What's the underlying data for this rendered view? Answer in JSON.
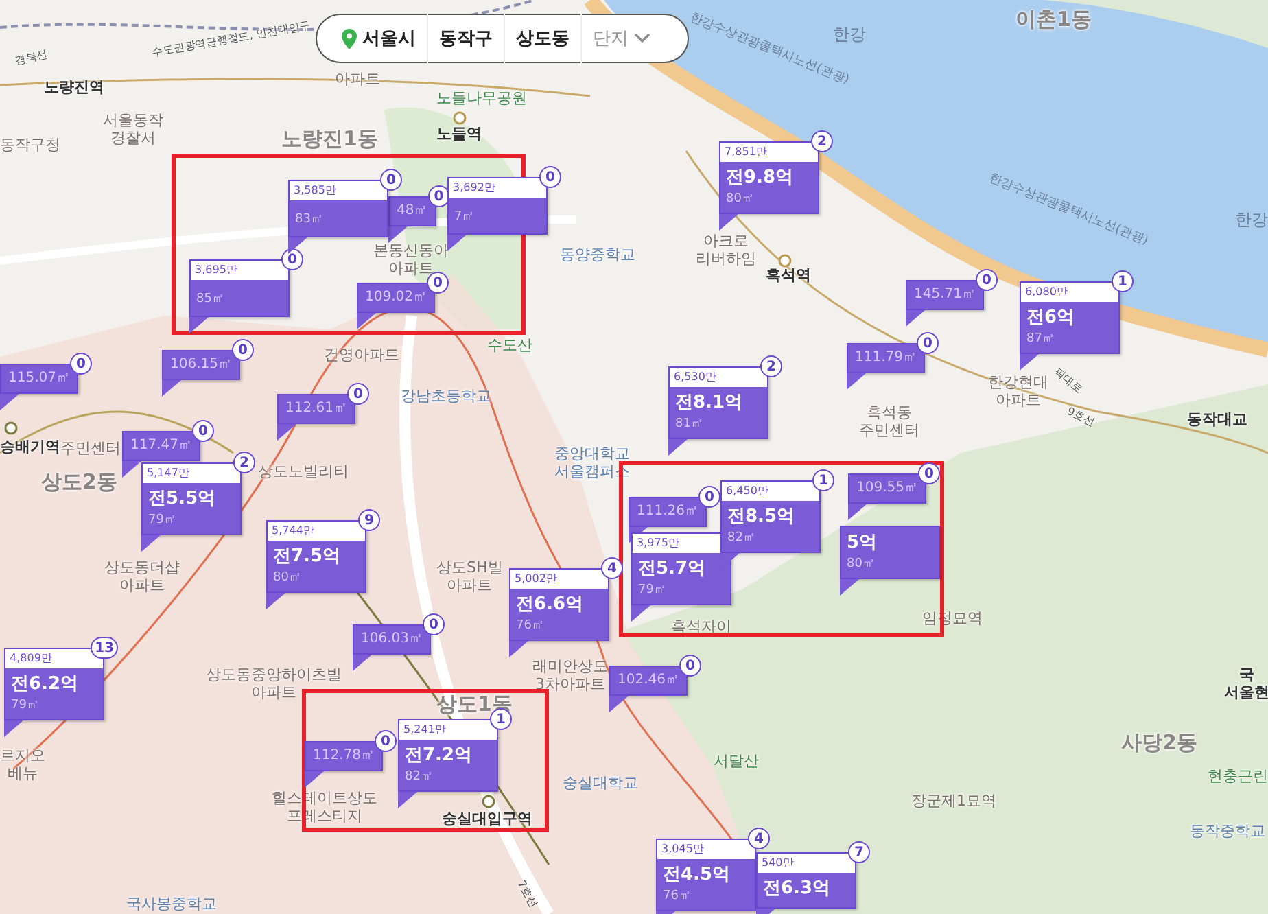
{
  "breadcrumb": {
    "items": [
      {
        "label": "서울시",
        "kind": "city"
      },
      {
        "label": "동작구",
        "kind": "region"
      },
      {
        "label": "상도동",
        "kind": "region"
      },
      {
        "label": "단지",
        "kind": "dropdown"
      }
    ]
  },
  "places": [
    {
      "text": "경북선",
      "kind": "line"
    },
    {
      "text": "수도권광역급행철도, 인천대입구",
      "kind": "line"
    },
    {
      "text": "노량진역",
      "kind": "station"
    },
    {
      "text": "서울동작\n경찰서",
      "kind": "poi"
    },
    {
      "text": "동작구청",
      "kind": "poi"
    },
    {
      "text": "아파트",
      "kind": "poi"
    },
    {
      "text": "노들나무공원",
      "kind": "park"
    },
    {
      "text": "노량진1동",
      "kind": "district"
    },
    {
      "text": "노들역",
      "kind": "station"
    },
    {
      "text": "본동신동아\n아파트",
      "kind": "poi"
    },
    {
      "text": "동양중학교",
      "kind": "school"
    },
    {
      "text": "수도산",
      "kind": "park"
    },
    {
      "text": "건영아파트",
      "kind": "poi"
    },
    {
      "text": "강남초등학교",
      "kind": "school"
    },
    {
      "text": "중앙대학교\n서울캠퍼스",
      "kind": "school"
    },
    {
      "text": "한강",
      "kind": "water"
    },
    {
      "text": "이촌1동",
      "kind": "district"
    },
    {
      "text": "한강수상관광콜택시노선(관광)",
      "kind": "waterline"
    },
    {
      "text": "한강수상관광콜택시노선(관광)",
      "kind": "waterline"
    },
    {
      "text": "한강",
      "kind": "water"
    },
    {
      "text": "아크로\n리버하임",
      "kind": "poi"
    },
    {
      "text": "흑석역",
      "kind": "station"
    },
    {
      "text": "한강현대\n아파트",
      "kind": "poi"
    },
    {
      "text": "흑석동\n주민센터",
      "kind": "poi"
    },
    {
      "text": "동작대교",
      "kind": "station"
    },
    {
      "text": "9호선",
      "kind": "line"
    },
    {
      "text": "픽대로",
      "kind": "line"
    },
    {
      "text": "승배기역",
      "kind": "station"
    },
    {
      "text": "주민센터",
      "kind": "poi"
    },
    {
      "text": "상도2동",
      "kind": "district"
    },
    {
      "text": "상도동더샵\n아파트",
      "kind": "poi"
    },
    {
      "text": "상도노빌리티",
      "kind": "poi"
    },
    {
      "text": "상도SH빌\n아파트",
      "kind": "poi"
    },
    {
      "text": "래미안상도\n3차아파트",
      "kind": "poi"
    },
    {
      "text": "상도동중앙하이츠빌\n아파트",
      "kind": "poi"
    },
    {
      "text": "상도1동",
      "kind": "district"
    },
    {
      "text": "힐스테이트상도\n프레스티지",
      "kind": "poi"
    },
    {
      "text": "숭실대입구역",
      "kind": "station"
    },
    {
      "text": "숭실대학교",
      "kind": "school"
    },
    {
      "text": "흑석자이",
      "kind": "poi"
    },
    {
      "text": "서달산",
      "kind": "park"
    },
    {
      "text": "임정묘역",
      "kind": "poi"
    },
    {
      "text": "장군제1묘역",
      "kind": "poi"
    },
    {
      "text": "사당2동",
      "kind": "district"
    },
    {
      "text": "국\n서울현",
      "kind": "station"
    },
    {
      "text": "현충근린",
      "kind": "park"
    },
    {
      "text": "동작중학교",
      "kind": "school"
    },
    {
      "text": "르지오\n베뉴",
      "kind": "poi"
    },
    {
      "text": "국사봉중학교",
      "kind": "school"
    },
    {
      "text": "7호선",
      "kind": "line"
    }
  ],
  "markers": [
    {
      "kind": "price",
      "price": "3,585만",
      "area": "83㎡",
      "count": "0"
    },
    {
      "kind": "area",
      "area": "48㎡",
      "count": "0"
    },
    {
      "kind": "price",
      "price": "3,692만",
      "area": "7㎡",
      "count": "0"
    },
    {
      "kind": "price",
      "price": "3,695만",
      "area": "85㎡",
      "count": "0"
    },
    {
      "kind": "area",
      "area": "109.02㎡",
      "count": "0"
    },
    {
      "kind": "area",
      "area": "106.15㎡",
      "count": "0"
    },
    {
      "kind": "area",
      "area": "115.07㎡",
      "count": "0"
    },
    {
      "kind": "area",
      "area": "112.61㎡",
      "count": "0"
    },
    {
      "kind": "area",
      "area": "117.47㎡",
      "count": "0"
    },
    {
      "kind": "full",
      "price": "7,851만",
      "value": "전9.8억",
      "area": "80㎡",
      "count": "2"
    },
    {
      "kind": "area",
      "area": "145.71㎡",
      "count": "0"
    },
    {
      "kind": "full",
      "price": "6,080만",
      "value": "전6억",
      "area": "87㎡",
      "count": "1"
    },
    {
      "kind": "area",
      "area": "111.79㎡",
      "count": "0"
    },
    {
      "kind": "full",
      "price": "6,530만",
      "value": "전8.1억",
      "area": "81㎡",
      "count": "2"
    },
    {
      "kind": "full",
      "price": "5,147만",
      "value": "전5.5억",
      "area": "79㎡",
      "count": "2"
    },
    {
      "kind": "full",
      "price": "5,744만",
      "value": "전7.5억",
      "area": "80㎡",
      "count": "9"
    },
    {
      "kind": "area",
      "area": "106.03㎡",
      "count": "0"
    },
    {
      "kind": "full",
      "price": "5,002만",
      "value": "전6.6억",
      "area": "76㎡",
      "count": "4"
    },
    {
      "kind": "full",
      "price": "4,809만",
      "value": "전6.2억",
      "area": "79㎡",
      "count": "13"
    },
    {
      "kind": "area",
      "area": "102.46㎡",
      "count": "0"
    },
    {
      "kind": "area",
      "area": "112.78㎡",
      "count": "0"
    },
    {
      "kind": "full",
      "price": "5,241만",
      "value": "전7.2억",
      "area": "82㎡",
      "count": "1"
    },
    {
      "kind": "full",
      "value": "5억",
      "area": "80㎡"
    },
    {
      "kind": "area",
      "area": "111.26㎡",
      "count": "0"
    },
    {
      "kind": "full",
      "price": "3,975만",
      "value": "전5.7억",
      "area": "79㎡"
    },
    {
      "kind": "full",
      "price": "6,450만",
      "value": "전8.5억",
      "area": "82㎡",
      "count": "1"
    },
    {
      "kind": "area",
      "area": "109.55㎡",
      "count": "0"
    },
    {
      "kind": "full",
      "price": "3,045만",
      "value": "전4.5억",
      "area": "76㎡",
      "count": "4"
    },
    {
      "kind": "full",
      "price": "540만",
      "value": "전6.3억",
      "count": "7"
    }
  ]
}
